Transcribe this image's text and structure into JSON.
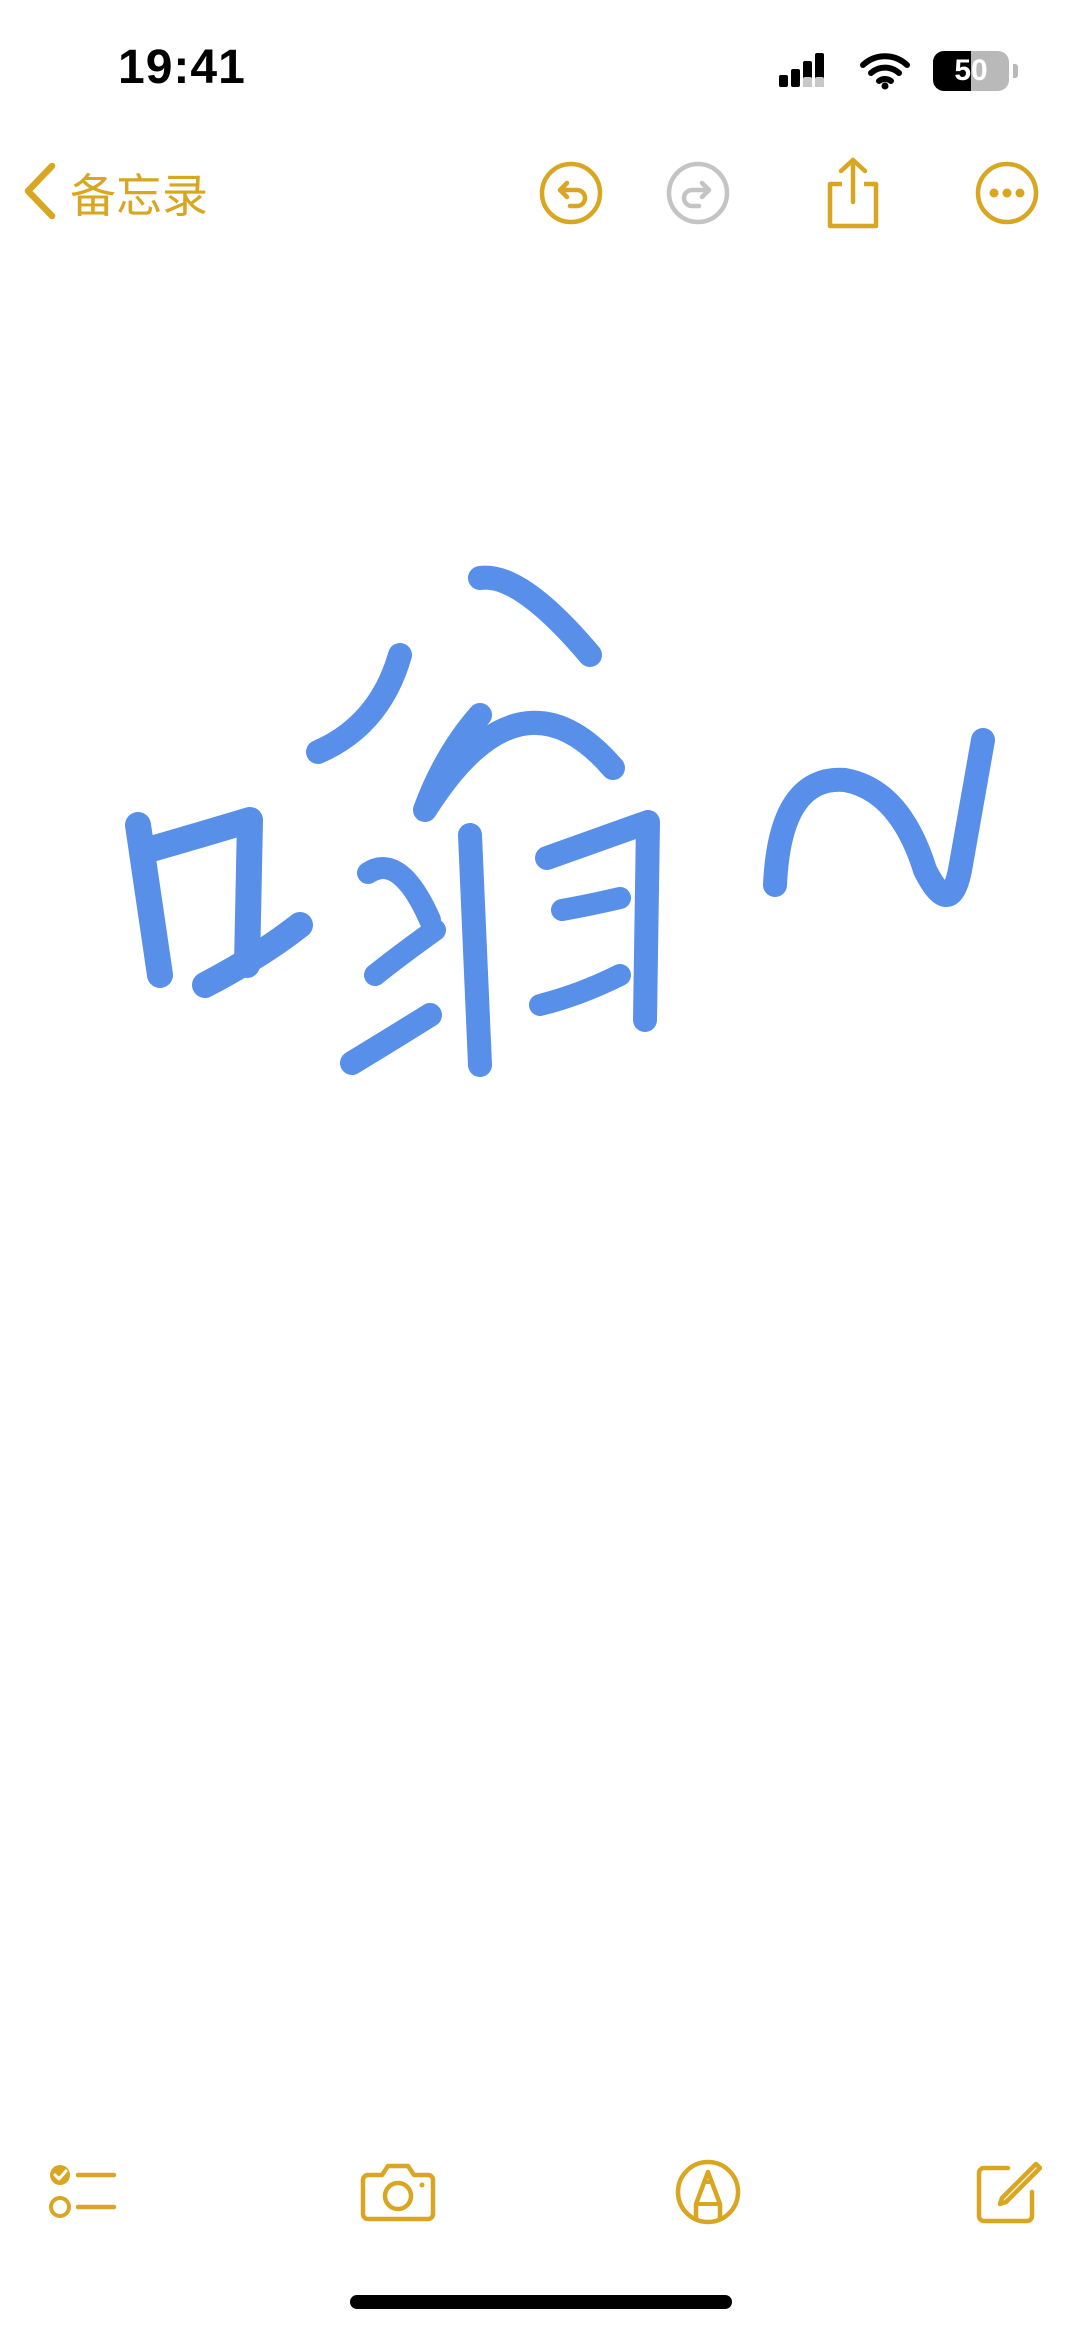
{
  "status_bar": {
    "time": "19:41",
    "battery_level": "50",
    "battery_fraction": 0.5
  },
  "nav": {
    "back_label": "备忘录",
    "icons": {
      "back": "chevron-left-icon",
      "undo": "undo-icon",
      "redo": "redo-icon",
      "share": "share-icon",
      "more": "more-icon"
    },
    "redo_enabled": false
  },
  "toolbar": {
    "icons": [
      "checklist-icon",
      "camera-icon",
      "markup-pen-icon",
      "compose-icon"
    ]
  },
  "colors": {
    "accent": "#d9a621",
    "disabled": "#c4c4c4",
    "ink": "#4a86e8",
    "background": "#ffffff"
  }
}
